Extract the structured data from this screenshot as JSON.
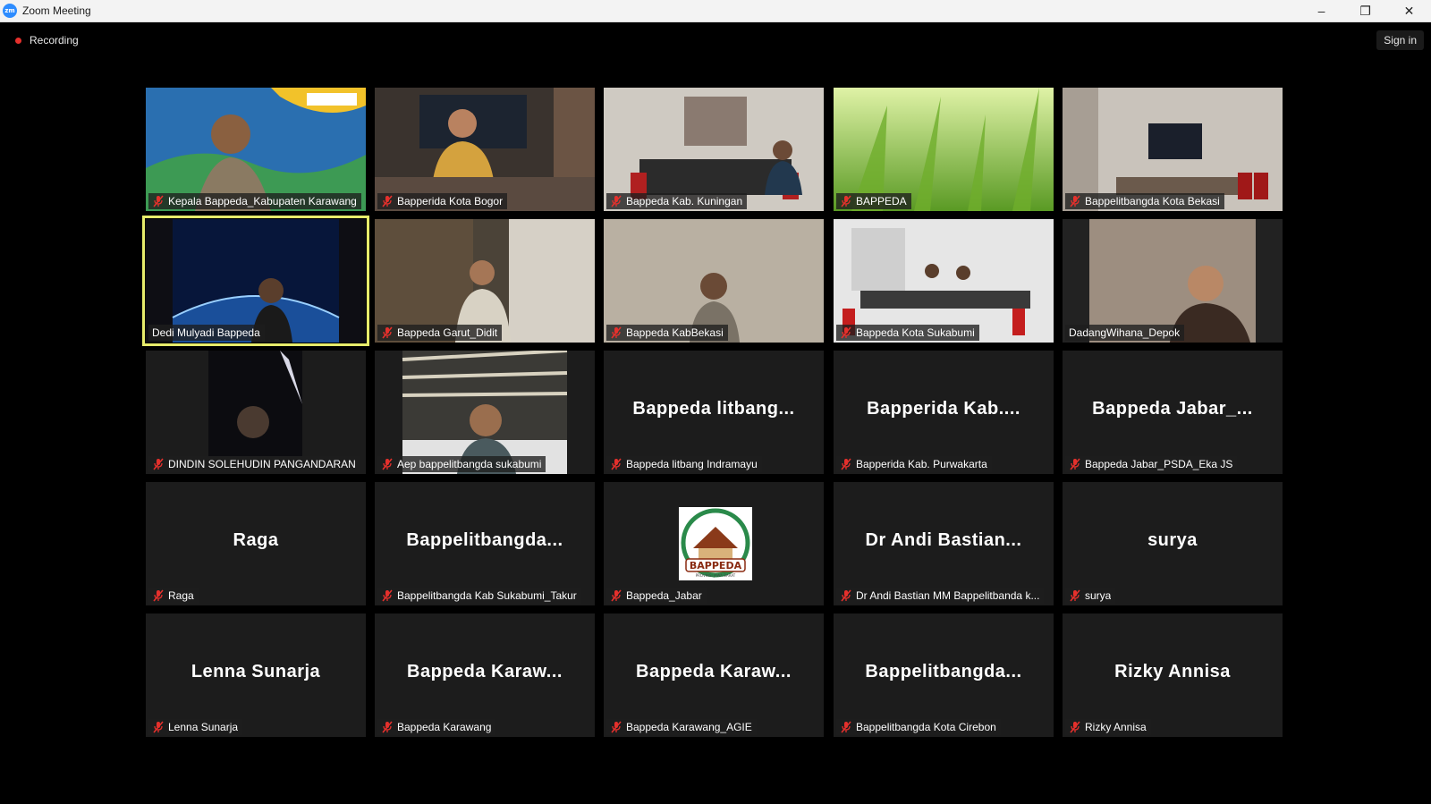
{
  "window": {
    "title": "Zoom Meeting",
    "icon": "zoom-app-icon",
    "icon_text": "zm"
  },
  "controls": {
    "minimize": "–",
    "restore": "❐",
    "close": "✕"
  },
  "topbar": {
    "recording_label": "Recording",
    "signin_label": "Sign in"
  },
  "colors": {
    "recording_red": "#e5302c",
    "active_speaker": "#e7ec6b",
    "mute_red": "#e5302c",
    "zoom_blue": "#2d8cff"
  },
  "participants": [
    {
      "name": "Kepala Bappeda_Kabupaten Karawang",
      "muted": true,
      "video": "sky-banner"
    },
    {
      "name": "Bapperida Kota Bogor",
      "muted": true,
      "video": "office"
    },
    {
      "name": "Bappeda Kab. Kuningan",
      "muted": true,
      "video": "meeting-room"
    },
    {
      "name": "BAPPEDA",
      "muted": true,
      "video": "grass"
    },
    {
      "name": "Bappelitbangda Kota Bekasi",
      "muted": true,
      "video": "conference-room"
    },
    {
      "name": "Dedi Mulyadi Bappeda",
      "muted": false,
      "video": "earth",
      "active": true
    },
    {
      "name": "Bappeda Garut_Didit",
      "muted": true,
      "video": "bookshelf"
    },
    {
      "name": "Bappeda KabBekasi",
      "muted": true,
      "video": "wallpaper"
    },
    {
      "name": "Bappeda Kota Sukabumi",
      "muted": true,
      "video": "meeting-room-white"
    },
    {
      "name": "DadangWihana_Depok",
      "muted": false,
      "video": "person-dark"
    },
    {
      "name": "DINDIN SOLEHUDIN PANGANDARAN",
      "muted": true,
      "video": "car"
    },
    {
      "name": "Aep bappelitbangda sukabumi",
      "muted": true,
      "video": "ceiling"
    },
    {
      "name": "Bappeda litbang Indramayu",
      "display": "Bappeda litbang...",
      "muted": true
    },
    {
      "name": "Bapperida Kab. Purwakarta",
      "display": "Bapperida Kab....",
      "muted": true
    },
    {
      "name": "Bappeda Jabar_PSDA_Eka JS",
      "display": "Bappeda Jabar_...",
      "muted": true
    },
    {
      "name": "Raga",
      "display": "Raga",
      "muted": true
    },
    {
      "name": "Bappelitbangda Kab Sukabumi_Takur",
      "display": "Bappelitbangda...",
      "muted": true
    },
    {
      "name": "Bappeda_Jabar",
      "muted": true,
      "video": "logo",
      "logo_text": "BAPPEDA",
      "logo_subtext": "PROVINSI JAWA BARAT"
    },
    {
      "name": "Dr Andi Bastian MM Bappelitbanda k...",
      "display": "Dr Andi Bastian...",
      "muted": true
    },
    {
      "name": "surya",
      "display": "surya",
      "muted": true
    },
    {
      "name": "Lenna Sunarja",
      "display": "Lenna Sunarja",
      "muted": true
    },
    {
      "name": "Bappeda Karawang",
      "display": "Bappeda Karaw...",
      "muted": true
    },
    {
      "name": "Bappeda Karawang_AGIE",
      "display": "Bappeda Karaw...",
      "muted": true
    },
    {
      "name": "Bappelitbangda Kota Cirebon",
      "display": "Bappelitbangda...",
      "muted": true
    },
    {
      "name": "Rizky Annisa",
      "display": "Rizky Annisa",
      "muted": true
    }
  ]
}
